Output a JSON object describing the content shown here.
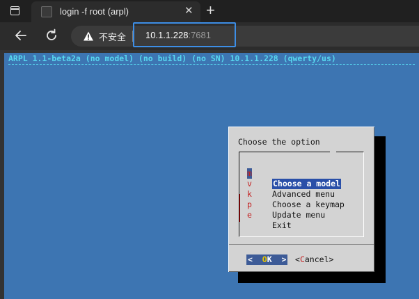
{
  "browser": {
    "tab_title": "login -f root (arpl)",
    "tab_close": "✕",
    "new_tab": "+",
    "insecure_label": "不安全",
    "url_host": "10.1.1.228",
    "url_port": ":7681"
  },
  "terminal": {
    "title_line": "ARPL 1.1-beta2a (no model) (no build) (no SN) 10.1.1.228 (qwerty/us)",
    "dialog": {
      "title": "Choose the option",
      "items": [
        {
          "key": "m",
          "label": "Choose a model",
          "selected": true
        },
        {
          "key": "v",
          "label": "Advanced menu"
        },
        {
          "key": "k",
          "label": "Choose a keymap"
        },
        {
          "key": "p",
          "label": "Update menu"
        },
        {
          "key": "e",
          "label": "Exit"
        }
      ],
      "ok_left": "<  ",
      "ok_hot": "O",
      "ok_rest": "K  >",
      "cancel_left": "<",
      "cancel_hot": "C",
      "cancel_rest": "ancel>"
    }
  },
  "colors": {
    "terminal_bg": "#3d75b2",
    "title_cyan": "#57d7ef",
    "dialog_bg": "#d3d3d3",
    "selection": "#2a4fa8",
    "hotkey_red": "#c42020",
    "focus_ring": "#3d8ee6"
  }
}
